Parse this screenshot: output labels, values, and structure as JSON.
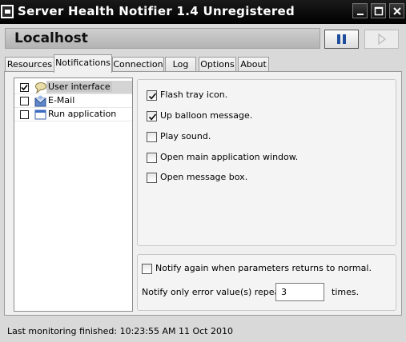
{
  "window": {
    "title": "Server Health Notifier 1.4 Unregistered"
  },
  "host": {
    "name": "Localhost"
  },
  "tabs": [
    {
      "label": "Resources"
    },
    {
      "label": "Notifications"
    },
    {
      "label": "Connection"
    },
    {
      "label": "Log"
    },
    {
      "label": "Options"
    },
    {
      "label": "About"
    }
  ],
  "active_tab": "Notifications",
  "tree": {
    "items": [
      {
        "label": "User interface",
        "checked": true,
        "icon": "speech-bubble-icon",
        "selected": true
      },
      {
        "label": "E-Mail",
        "checked": false,
        "icon": "envelope-icon",
        "selected": false
      },
      {
        "label": "Run application",
        "checked": false,
        "icon": "window-icon",
        "selected": false
      }
    ]
  },
  "options": [
    {
      "label": "Flash tray icon.",
      "checked": true
    },
    {
      "label": "Up balloon message.",
      "checked": true
    },
    {
      "label": "Play sound.",
      "checked": false
    },
    {
      "label": "Open main application window.",
      "checked": false
    },
    {
      "label": "Open message box.",
      "checked": false
    }
  ],
  "repeat": {
    "notify_again_label": "Notify again when parameters returns to normal.",
    "notify_again_checked": false,
    "repeats_label": "Notify only error value(s) repeats",
    "repeats_value": "3",
    "times_label": "times."
  },
  "status": {
    "text": "Last monitoring finished: 10:23:55 AM  11 Oct 2010"
  },
  "colors": {
    "titlebar": "#000000",
    "window_bg": "#d9d9d9",
    "panel_bg": "#f0f0f0",
    "pause_icon": "#1f4f9c"
  }
}
